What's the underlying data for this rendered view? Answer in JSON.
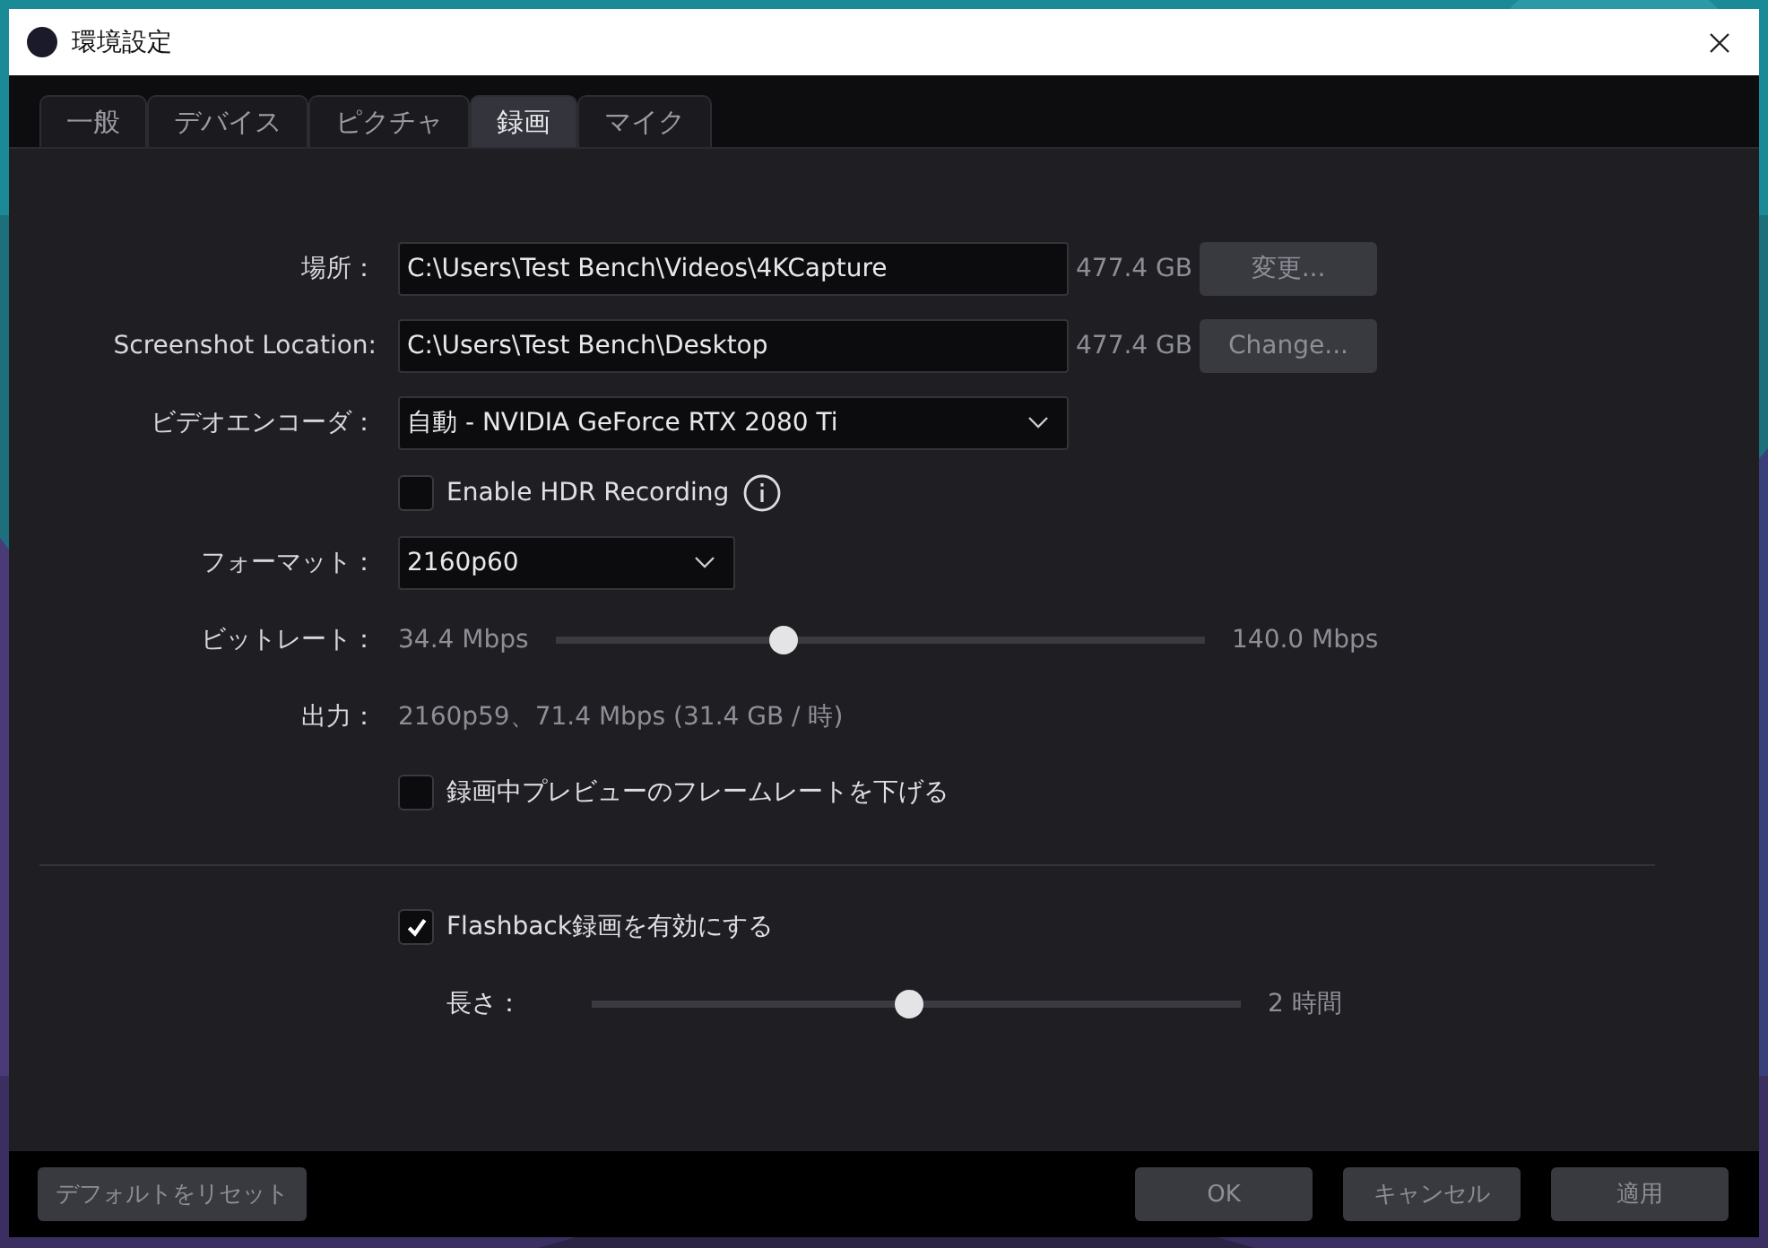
{
  "window": {
    "title": "環境設定"
  },
  "tabs": [
    {
      "label": "一般",
      "selected": false
    },
    {
      "label": "デバイス",
      "selected": false
    },
    {
      "label": "ピクチャ",
      "selected": false
    },
    {
      "label": "録画",
      "selected": true
    },
    {
      "label": "マイク",
      "selected": false
    }
  ],
  "form": {
    "location": {
      "label": "場所：",
      "value": "C:\\Users\\Test Bench\\Videos\\4KCapture",
      "free_space": "477.4 GB",
      "button": "変更..."
    },
    "screenshot_location": {
      "label": "Screenshot Location:",
      "value": "C:\\Users\\Test Bench\\Desktop",
      "free_space": "477.4 GB",
      "button": "Change..."
    },
    "video_encoder": {
      "label": "ビデオエンコーダ：",
      "value": "自動 - NVIDIA GeForce RTX 2080 Ti"
    },
    "hdr": {
      "label": "Enable HDR Recording",
      "checked": false
    },
    "format": {
      "label": "フォーマット：",
      "value": "2160p60"
    },
    "bitrate": {
      "label": "ビットレート：",
      "min": "34.4 Mbps",
      "level": 0.35,
      "max": "140.0 Mbps"
    },
    "output": {
      "label": "出力：",
      "value": "2160p59、71.4 Mbps (31.4 GB / 時)"
    },
    "reduce_preview": {
      "label": "録画中プレビューのフレームレートを下げる",
      "checked": false
    },
    "flashback": {
      "label": "Flashback録画を有効にする",
      "checked": true
    },
    "length": {
      "label": "長さ：",
      "level": 0.49,
      "reading": "2 時間"
    }
  },
  "footer": {
    "reset": "デフォルトをリセット",
    "buttons": [
      "OK",
      "キャンセル",
      "適用"
    ]
  }
}
